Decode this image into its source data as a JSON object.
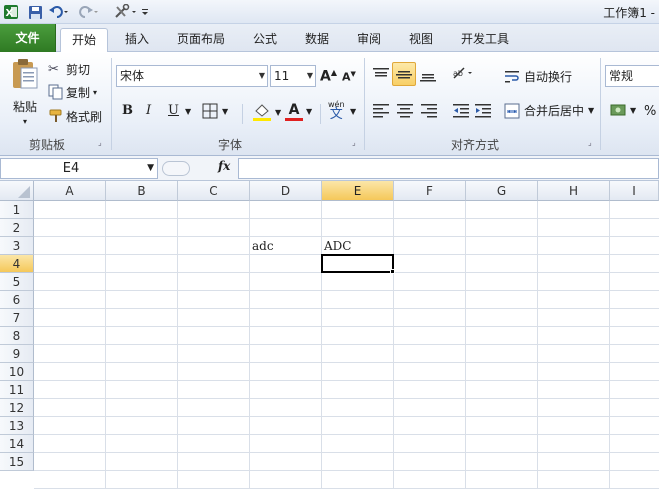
{
  "app": {
    "window_title": "工作簿1 -"
  },
  "tabs": [
    "文件",
    "开始",
    "插入",
    "页面布局",
    "公式",
    "数据",
    "审阅",
    "视图",
    "开发工具"
  ],
  "ribbon": {
    "clipboard": {
      "paste": "粘贴",
      "cut": "剪切",
      "copy": "复制",
      "format_painter": "格式刷",
      "group_label": "剪贴板"
    },
    "font": {
      "font_name": "宋体",
      "font_size": "11",
      "bold": "B",
      "italic": "I",
      "underline": "U",
      "font_color_letter": "A",
      "group_label": "字体",
      "wen": "wén",
      "wen_char": "文"
    },
    "alignment": {
      "wrap_text": "自动换行",
      "merge_center": "合并后居中",
      "group_label": "对齐方式"
    },
    "number": {
      "format": "常规",
      "percent": "%"
    }
  },
  "formula_bar": {
    "name_box": "E4",
    "fx": "fx",
    "content": ""
  },
  "grid": {
    "columns": [
      "A",
      "B",
      "C",
      "D",
      "E",
      "F",
      "G",
      "H",
      "I"
    ],
    "rows": [
      "1",
      "2",
      "3",
      "4",
      "5",
      "6",
      "7",
      "8",
      "9",
      "10",
      "11",
      "12",
      "13",
      "14",
      "15"
    ],
    "selected_cell": "E4",
    "cells": {
      "D3": "adc",
      "E3": "ADC"
    }
  },
  "colors": {
    "file_tab": "#2f7a23",
    "selected_header": "#f5c85a",
    "font_color_bar": "#e02020",
    "highlight_bar": "#ffe800"
  }
}
